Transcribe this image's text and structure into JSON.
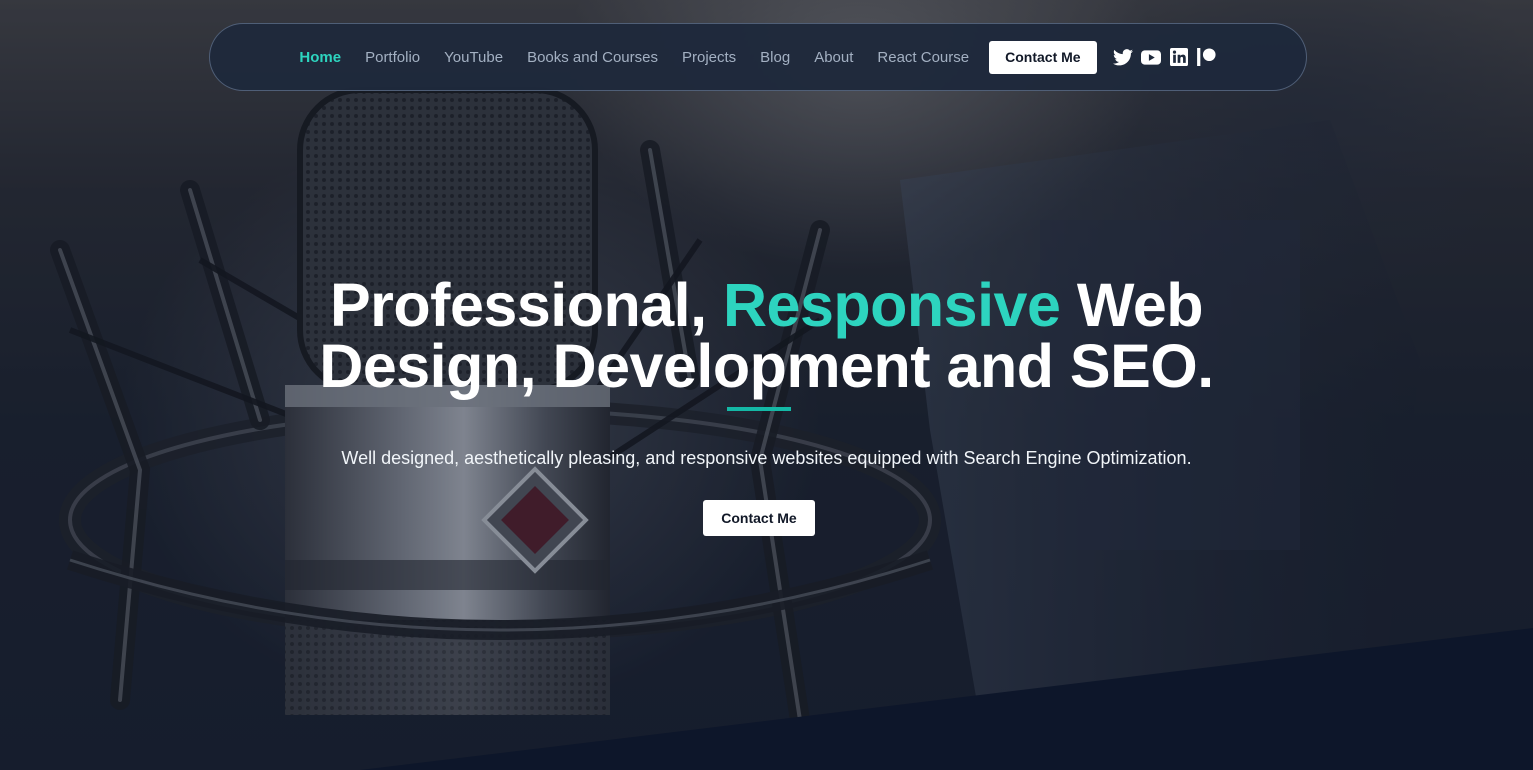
{
  "nav": {
    "items": [
      {
        "label": "Home",
        "active": true
      },
      {
        "label": "Portfolio",
        "active": false
      },
      {
        "label": "YouTube",
        "active": false
      },
      {
        "label": "Books and Courses",
        "active": false
      },
      {
        "label": "Projects",
        "active": false
      },
      {
        "label": "Blog",
        "active": false
      },
      {
        "label": "About",
        "active": false
      },
      {
        "label": "React Course",
        "active": false
      }
    ],
    "contact_label": "Contact Me",
    "social_icons": [
      "twitter-icon",
      "youtube-icon",
      "linkedin-icon",
      "patreon-icon"
    ]
  },
  "hero": {
    "headline_part1": "Professional, ",
    "headline_accent": "Responsive",
    "headline_part2": " Web",
    "headline_line2": "Design, Development and SEO.",
    "subtext": "Well designed, aesthetically pleasing, and responsive websites equipped with Search Engine Optimization.",
    "cta_label": "Contact Me"
  },
  "colors": {
    "accent": "#2dd4bf",
    "nav_bg": "#1e293b",
    "page_bg": "#0c1424"
  }
}
